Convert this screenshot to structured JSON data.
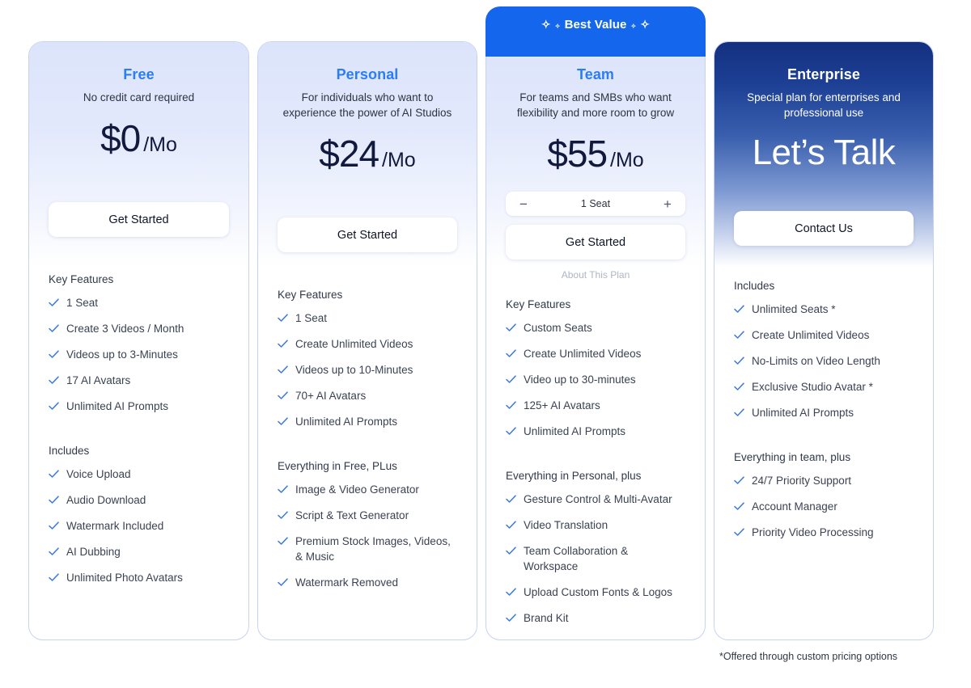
{
  "badge": {
    "label": "Best Value",
    "sparkle_icon": "sparkle-icon"
  },
  "footnote": "*Offered through custom pricing options",
  "colors": {
    "accent_blue": "#2b7cf6",
    "badge_blue": "#1466ec",
    "check_blue": "#3b7ae0",
    "price_navy": "#111a3d",
    "enterprise_gradient_top": "#14307f"
  },
  "plans": [
    {
      "id": "free",
      "name": "Free",
      "description": "No credit card required",
      "price_main": "$0",
      "price_unit": "/Mo",
      "cta_label": "Get Started",
      "sections": [
        {
          "title": "Key Features",
          "items": [
            "1 Seat",
            "Create 3 Videos / Month",
            "Videos up to 3-Minutes",
            "17 AI Avatars",
            "Unlimited AI Prompts"
          ]
        },
        {
          "title": "Includes",
          "items": [
            "Voice Upload",
            "Audio Download",
            "Watermark Included",
            "AI Dubbing",
            "Unlimited Photo Avatars"
          ]
        }
      ]
    },
    {
      "id": "personal",
      "name": "Personal",
      "description": "For individuals who want to experience the power of AI Studios",
      "price_main": "$24",
      "price_unit": "/Mo",
      "cta_label": "Get Started",
      "sections": [
        {
          "title": "Key Features",
          "items": [
            "1 Seat",
            "Create Unlimited Videos",
            "Videos up to 10-Minutes",
            "70+ AI Avatars",
            "Unlimited AI Prompts"
          ]
        },
        {
          "title": "Everything in Free, PLus",
          "items": [
            "Image & Video Generator",
            "Script & Text Generator",
            "Premium Stock Images, Videos, & Music",
            "Watermark Removed"
          ]
        }
      ]
    },
    {
      "id": "team",
      "name": "Team",
      "description": "For teams and SMBs who want flexibility and more room to grow",
      "price_main": "$55",
      "price_unit": "/Mo",
      "seat_stepper": {
        "decrease_label": "−",
        "value": "1 Seat",
        "increase_label": "+"
      },
      "cta_label": "Get Started",
      "about_link": "About This Plan",
      "sections": [
        {
          "title": "Key Features",
          "items": [
            "Custom Seats",
            "Create Unlimited Videos",
            "Video up to 30-minutes",
            "125+ AI Avatars",
            "Unlimited AI Prompts"
          ]
        },
        {
          "title": "Everything in Personal, plus",
          "items": [
            "Gesture Control & Multi-Avatar",
            "Video Translation",
            "Team Collaboration & Workspace",
            "Upload Custom Fonts & Logos",
            "Brand Kit"
          ]
        }
      ]
    },
    {
      "id": "enterprise",
      "name": "Enterprise",
      "description": "Special plan for enterprises and professional use",
      "price_talk": "Let’s Talk",
      "cta_label": "Contact Us",
      "sections": [
        {
          "title": "Includes",
          "items": [
            "Unlimited Seats *",
            "Create Unlimited Videos",
            "No-Limits on Video Length",
            "Exclusive Studio Avatar *",
            "Unlimited AI Prompts"
          ]
        },
        {
          "title": "Everything in team, plus",
          "items": [
            "24/7 Priority Support",
            "Account Manager",
            "Priority Video Processing"
          ]
        }
      ]
    }
  ]
}
